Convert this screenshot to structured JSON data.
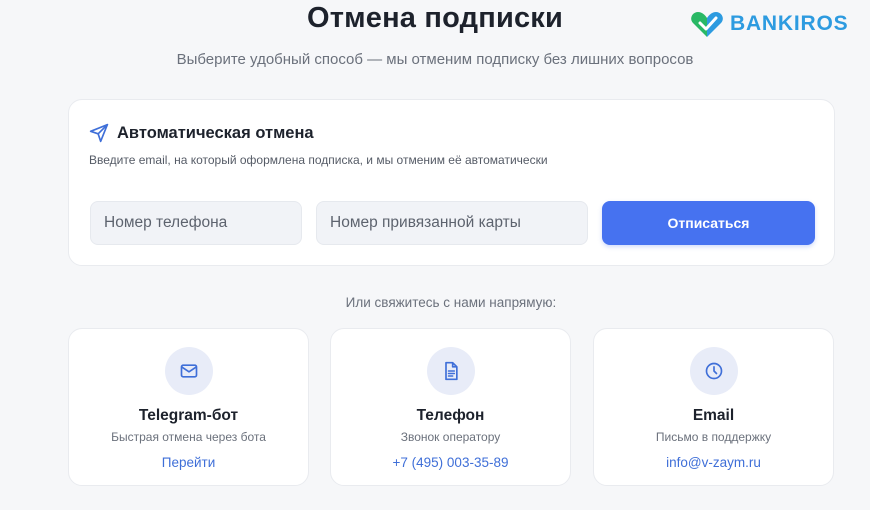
{
  "header": {
    "title": "Отмена подписки",
    "subtitle": "Выберите удобный способ — мы отменим подписку без лишних вопросов"
  },
  "logo": {
    "text": "BANKIROS",
    "icon": "heart-check-icon",
    "colors": {
      "green": "#29b865",
      "blue": "#2d9be0"
    }
  },
  "auto_cancel": {
    "icon": "paper-plane-icon",
    "title": "Автоматическая отмена",
    "description": "Введите email, на который оформлена подписка, и мы отменим её автоматически",
    "phone_placeholder": "Номер телефона",
    "card_placeholder": "Номер привязанной карты",
    "submit_label": "Отписаться"
  },
  "contact_prompt": "Или свяжитесь с нами напрямую:",
  "contacts": [
    {
      "icon": "mail-icon",
      "title": "Telegram-бот",
      "subtitle": "Быстрая отмена через бота",
      "link": "Перейти"
    },
    {
      "icon": "document-icon",
      "title": "Телефон",
      "subtitle": "Звонок оператору",
      "link": "+7 (495) 003-35-89"
    },
    {
      "icon": "clock-icon",
      "title": "Email",
      "subtitle": "Письмо в поддержку",
      "link": "info@v-zaym.ru"
    }
  ],
  "colors": {
    "accent": "#4672f0",
    "link": "#3f6fd8",
    "background": "#f6f7f9",
    "icon_circle": "#e8ecf8"
  }
}
